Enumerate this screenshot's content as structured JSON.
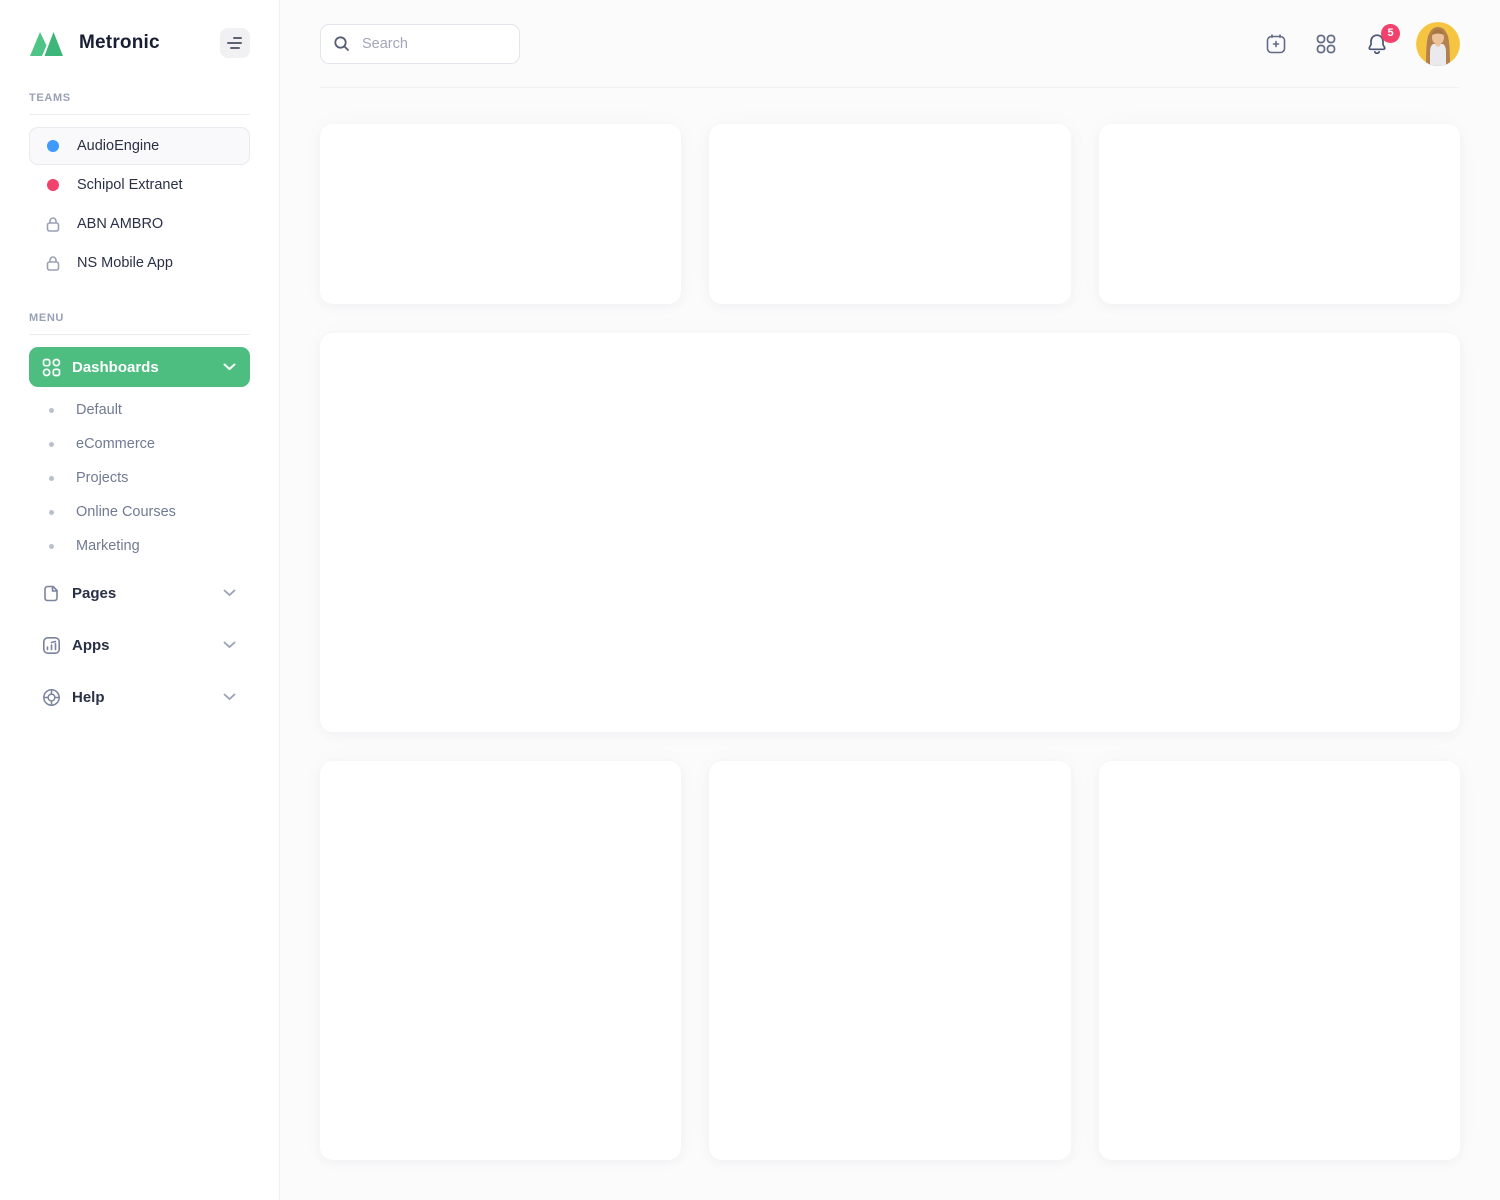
{
  "app": {
    "name": "Metronic"
  },
  "colors": {
    "accent-green": "#4dbe80",
    "danger": "#f1416c",
    "info-blue": "#3e9bfc"
  },
  "sidebar": {
    "teams_header": "TEAMS",
    "teams": [
      {
        "label": "AudioEngine",
        "indicator": "dot",
        "color": "#3e9bfc",
        "active": true
      },
      {
        "label": "Schipol Extranet",
        "indicator": "dot",
        "color": "#f1416c",
        "active": false
      },
      {
        "label": "ABN AMBRO",
        "indicator": "lock-icon",
        "active": false
      },
      {
        "label": "NS Mobile App",
        "indicator": "lock-icon",
        "active": false
      }
    ],
    "menu_header": "MENU",
    "menu": [
      {
        "label": "Dashboards",
        "icon": "grid-icon",
        "active": true,
        "expanded": true,
        "children": [
          "Default",
          "eCommerce",
          "Projects",
          "Online Courses",
          "Marketing"
        ]
      },
      {
        "label": "Pages",
        "icon": "page-icon",
        "active": false
      },
      {
        "label": "Apps",
        "icon": "chart-square-icon",
        "active": false
      },
      {
        "label": "Help",
        "icon": "lifebuoy-icon",
        "active": false
      }
    ]
  },
  "header": {
    "search_placeholder": "Search",
    "notification_count": "5",
    "icons": [
      "calendar-plus-icon",
      "apps-grid-icon",
      "bell-icon",
      "avatar"
    ]
  },
  "content": {
    "cards": [
      "stat-card-1",
      "stat-card-2",
      "stat-card-3",
      "main-panel",
      "panel-1",
      "panel-2",
      "panel-3"
    ]
  }
}
